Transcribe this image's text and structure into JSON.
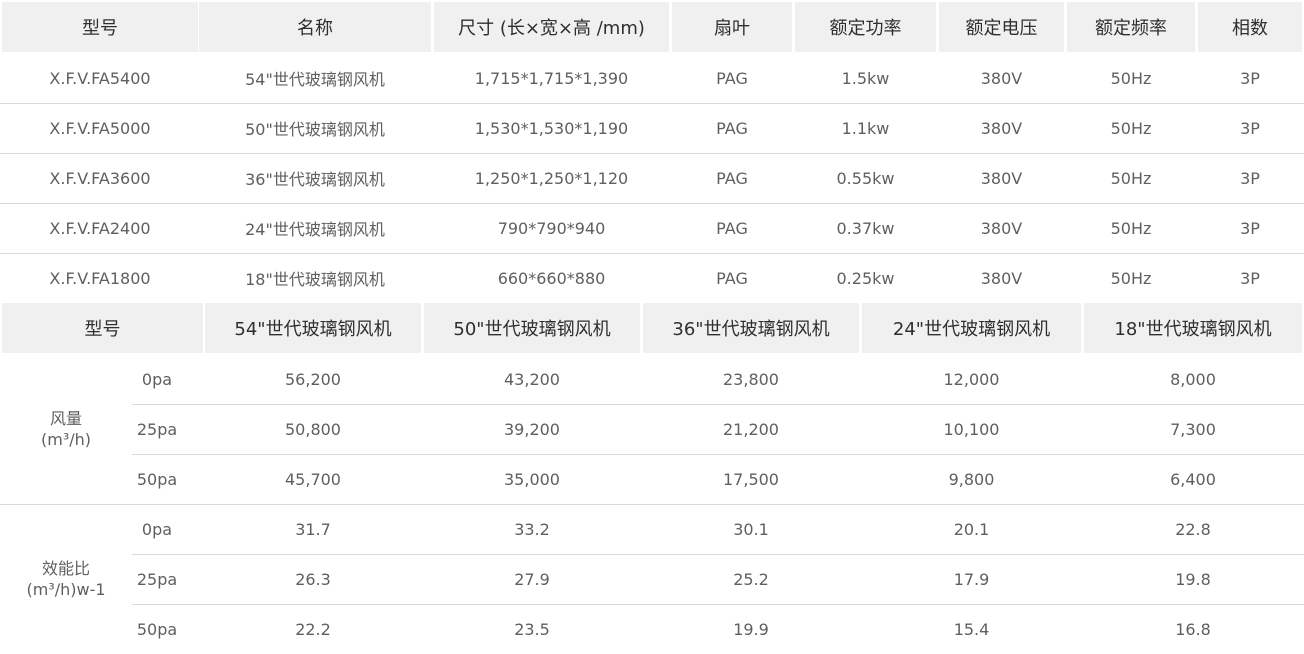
{
  "specs_table": {
    "headers": [
      "型号",
      "名称",
      "尺寸 (长×宽×高 /mm)",
      "扇叶",
      "额定功率",
      "额定电压",
      "额定频率",
      "相数"
    ],
    "rows": [
      [
        "X.F.V.FA5400",
        "54\"世代玻璃钢风机",
        "1,715*1,715*1,390",
        "PAG",
        "1.5kw",
        "380V",
        "50Hz",
        "3P"
      ],
      [
        "X.F.V.FA5000",
        "50\"世代玻璃钢风机",
        "1,530*1,530*1,190",
        "PAG",
        "1.1kw",
        "380V",
        "50Hz",
        "3P"
      ],
      [
        "X.F.V.FA3600",
        "36\"世代玻璃钢风机",
        "1,250*1,250*1,120",
        "PAG",
        "0.55kw",
        "380V",
        "50Hz",
        "3P"
      ],
      [
        "X.F.V.FA2400",
        "24\"世代玻璃钢风机",
        "790*790*940",
        "PAG",
        "0.37kw",
        "380V",
        "50Hz",
        "3P"
      ],
      [
        "X.F.V.FA1800",
        "18\"世代玻璃钢风机",
        "660*660*880",
        "PAG",
        "0.25kw",
        "380V",
        "50Hz",
        "3P"
      ]
    ]
  },
  "perf_table": {
    "header_label": "型号",
    "models": [
      "54\"世代玻璃钢风机",
      "50\"世代玻璃钢风机",
      "36\"世代玻璃钢风机",
      "24\"世代玻璃钢风机",
      "18\"世代玻璃钢风机"
    ],
    "groups": [
      {
        "label_line1": "风量",
        "label_line2": "(m³/h)",
        "rows": [
          {
            "pressure": "0pa",
            "values": [
              "56,200",
              "43,200",
              "23,800",
              "12,000",
              "8,000"
            ]
          },
          {
            "pressure": "25pa",
            "values": [
              "50,800",
              "39,200",
              "21,200",
              "10,100",
              "7,300"
            ]
          },
          {
            "pressure": "50pa",
            "values": [
              "45,700",
              "35,000",
              "17,500",
              "9,800",
              "6,400"
            ]
          }
        ]
      },
      {
        "label_line1": "效能比",
        "label_line2": "(m³/h)w-1",
        "rows": [
          {
            "pressure": "0pa",
            "values": [
              "31.7",
              "33.2",
              "30.1",
              "20.1",
              "22.8"
            ]
          },
          {
            "pressure": "25pa",
            "values": [
              "26.3",
              "27.9",
              "25.2",
              "17.9",
              "19.8"
            ]
          },
          {
            "pressure": "50pa",
            "values": [
              "22.2",
              "23.5",
              "19.9",
              "15.4",
              "16.8"
            ]
          }
        ]
      }
    ]
  },
  "colors": {
    "header_bg": "#f0f0f0",
    "divider": "#d9d9d9",
    "text": "#5f5f5f",
    "header_text": "#2f2f2f"
  }
}
